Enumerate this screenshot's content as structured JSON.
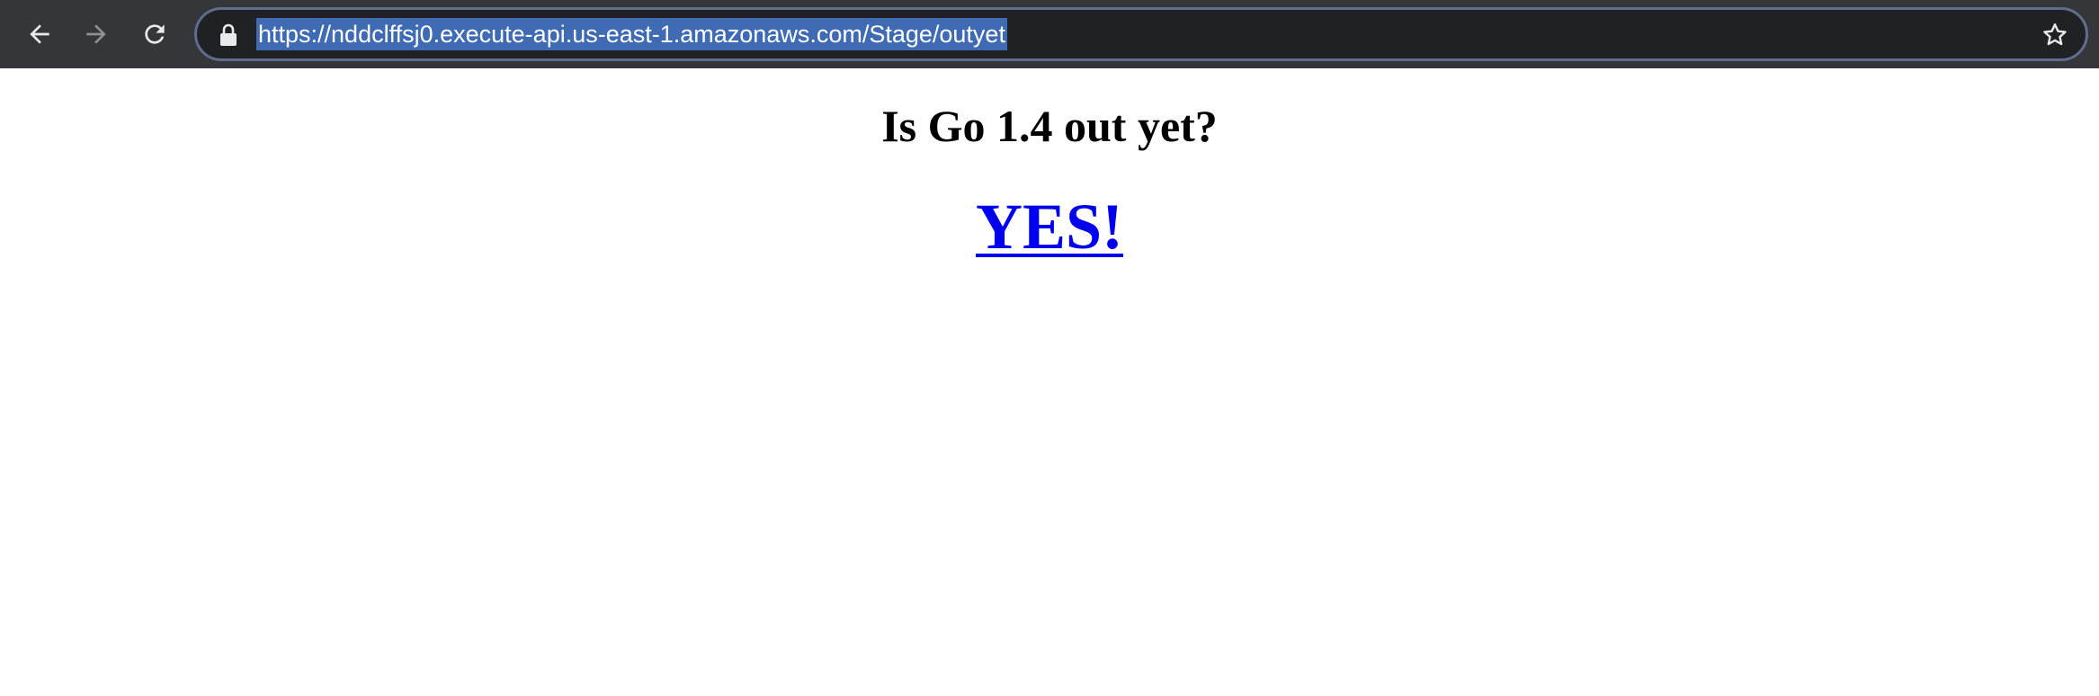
{
  "browser": {
    "url": "https://nddclffsj0.execute-api.us-east-1.amazonaws.com/Stage/outyet",
    "icons": {
      "back": "arrow-left-icon",
      "forward": "arrow-right-icon",
      "reload": "reload-icon",
      "lock": "lock-icon",
      "bookmark": "star-icon"
    },
    "colors": {
      "toolbar": "#35363a",
      "omnibox": "#202124",
      "selection": "#3f6ab4"
    }
  },
  "page": {
    "question": "Is Go 1.4 out yet?",
    "answer": "YES!",
    "colors": {
      "link": "#0000ee",
      "text": "#000000"
    }
  }
}
